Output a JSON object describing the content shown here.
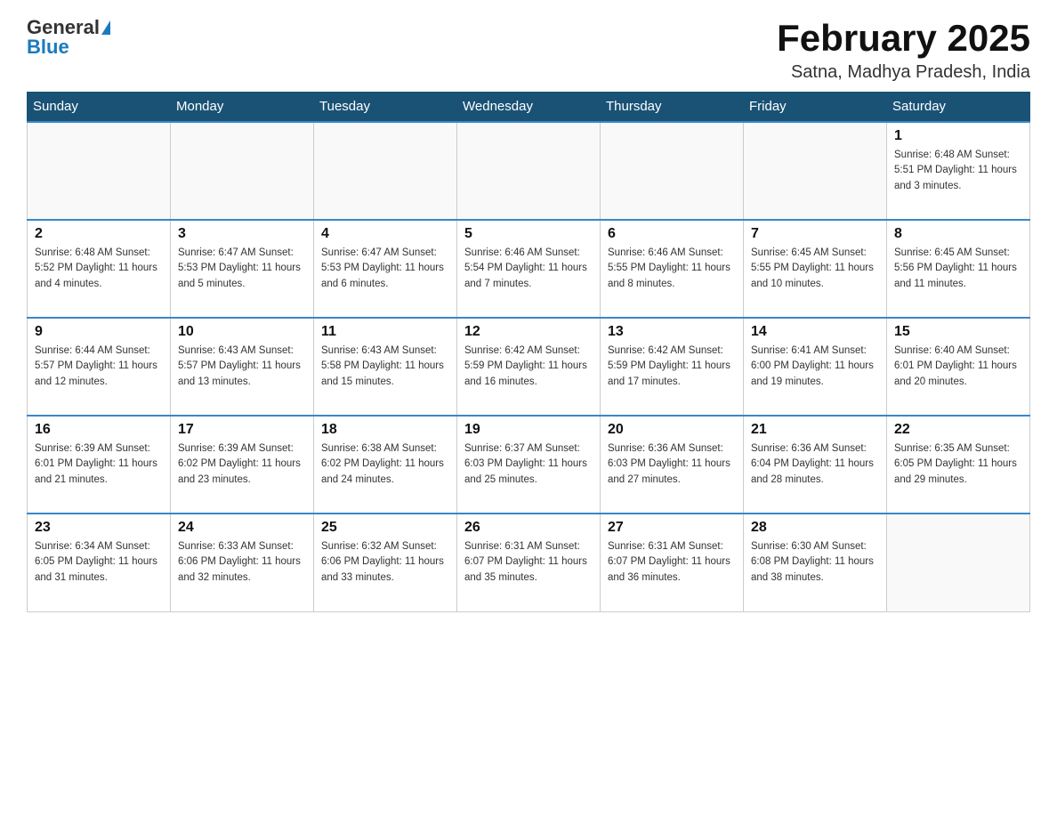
{
  "header": {
    "logo_general": "General",
    "logo_blue": "Blue",
    "month_title": "February 2025",
    "location": "Satna, Madhya Pradesh, India"
  },
  "weekdays": [
    "Sunday",
    "Monday",
    "Tuesday",
    "Wednesday",
    "Thursday",
    "Friday",
    "Saturday"
  ],
  "weeks": [
    [
      {
        "day": "",
        "info": ""
      },
      {
        "day": "",
        "info": ""
      },
      {
        "day": "",
        "info": ""
      },
      {
        "day": "",
        "info": ""
      },
      {
        "day": "",
        "info": ""
      },
      {
        "day": "",
        "info": ""
      },
      {
        "day": "1",
        "info": "Sunrise: 6:48 AM\nSunset: 5:51 PM\nDaylight: 11 hours and 3 minutes."
      }
    ],
    [
      {
        "day": "2",
        "info": "Sunrise: 6:48 AM\nSunset: 5:52 PM\nDaylight: 11 hours and 4 minutes."
      },
      {
        "day": "3",
        "info": "Sunrise: 6:47 AM\nSunset: 5:53 PM\nDaylight: 11 hours and 5 minutes."
      },
      {
        "day": "4",
        "info": "Sunrise: 6:47 AM\nSunset: 5:53 PM\nDaylight: 11 hours and 6 minutes."
      },
      {
        "day": "5",
        "info": "Sunrise: 6:46 AM\nSunset: 5:54 PM\nDaylight: 11 hours and 7 minutes."
      },
      {
        "day": "6",
        "info": "Sunrise: 6:46 AM\nSunset: 5:55 PM\nDaylight: 11 hours and 8 minutes."
      },
      {
        "day": "7",
        "info": "Sunrise: 6:45 AM\nSunset: 5:55 PM\nDaylight: 11 hours and 10 minutes."
      },
      {
        "day": "8",
        "info": "Sunrise: 6:45 AM\nSunset: 5:56 PM\nDaylight: 11 hours and 11 minutes."
      }
    ],
    [
      {
        "day": "9",
        "info": "Sunrise: 6:44 AM\nSunset: 5:57 PM\nDaylight: 11 hours and 12 minutes."
      },
      {
        "day": "10",
        "info": "Sunrise: 6:43 AM\nSunset: 5:57 PM\nDaylight: 11 hours and 13 minutes."
      },
      {
        "day": "11",
        "info": "Sunrise: 6:43 AM\nSunset: 5:58 PM\nDaylight: 11 hours and 15 minutes."
      },
      {
        "day": "12",
        "info": "Sunrise: 6:42 AM\nSunset: 5:59 PM\nDaylight: 11 hours and 16 minutes."
      },
      {
        "day": "13",
        "info": "Sunrise: 6:42 AM\nSunset: 5:59 PM\nDaylight: 11 hours and 17 minutes."
      },
      {
        "day": "14",
        "info": "Sunrise: 6:41 AM\nSunset: 6:00 PM\nDaylight: 11 hours and 19 minutes."
      },
      {
        "day": "15",
        "info": "Sunrise: 6:40 AM\nSunset: 6:01 PM\nDaylight: 11 hours and 20 minutes."
      }
    ],
    [
      {
        "day": "16",
        "info": "Sunrise: 6:39 AM\nSunset: 6:01 PM\nDaylight: 11 hours and 21 minutes."
      },
      {
        "day": "17",
        "info": "Sunrise: 6:39 AM\nSunset: 6:02 PM\nDaylight: 11 hours and 23 minutes."
      },
      {
        "day": "18",
        "info": "Sunrise: 6:38 AM\nSunset: 6:02 PM\nDaylight: 11 hours and 24 minutes."
      },
      {
        "day": "19",
        "info": "Sunrise: 6:37 AM\nSunset: 6:03 PM\nDaylight: 11 hours and 25 minutes."
      },
      {
        "day": "20",
        "info": "Sunrise: 6:36 AM\nSunset: 6:03 PM\nDaylight: 11 hours and 27 minutes."
      },
      {
        "day": "21",
        "info": "Sunrise: 6:36 AM\nSunset: 6:04 PM\nDaylight: 11 hours and 28 minutes."
      },
      {
        "day": "22",
        "info": "Sunrise: 6:35 AM\nSunset: 6:05 PM\nDaylight: 11 hours and 29 minutes."
      }
    ],
    [
      {
        "day": "23",
        "info": "Sunrise: 6:34 AM\nSunset: 6:05 PM\nDaylight: 11 hours and 31 minutes."
      },
      {
        "day": "24",
        "info": "Sunrise: 6:33 AM\nSunset: 6:06 PM\nDaylight: 11 hours and 32 minutes."
      },
      {
        "day": "25",
        "info": "Sunrise: 6:32 AM\nSunset: 6:06 PM\nDaylight: 11 hours and 33 minutes."
      },
      {
        "day": "26",
        "info": "Sunrise: 6:31 AM\nSunset: 6:07 PM\nDaylight: 11 hours and 35 minutes."
      },
      {
        "day": "27",
        "info": "Sunrise: 6:31 AM\nSunset: 6:07 PM\nDaylight: 11 hours and 36 minutes."
      },
      {
        "day": "28",
        "info": "Sunrise: 6:30 AM\nSunset: 6:08 PM\nDaylight: 11 hours and 38 minutes."
      },
      {
        "day": "",
        "info": ""
      }
    ]
  ]
}
